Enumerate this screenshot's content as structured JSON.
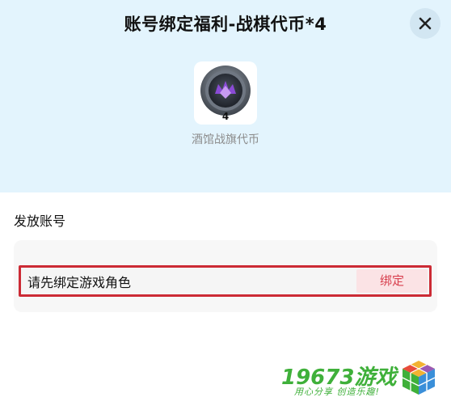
{
  "dialog": {
    "title": "账号绑定福利-战棋代币*4",
    "close_icon": "close-icon"
  },
  "reward": {
    "icon": "tavern-token-coin-icon",
    "count": "4",
    "name": "酒馆战旗代币"
  },
  "account": {
    "section_label": "发放账号",
    "placeholder": "请先绑定游戏角色",
    "bind_label": "绑定"
  },
  "watermark": {
    "brand": "19673游戏",
    "slogan": "用心分享 创造乐趣!"
  },
  "colors": {
    "header_bg": "#e3f4fd",
    "highlight_border": "#cc2b35",
    "bind_text": "#d8404e",
    "watermark_green": "#3fb03a"
  }
}
